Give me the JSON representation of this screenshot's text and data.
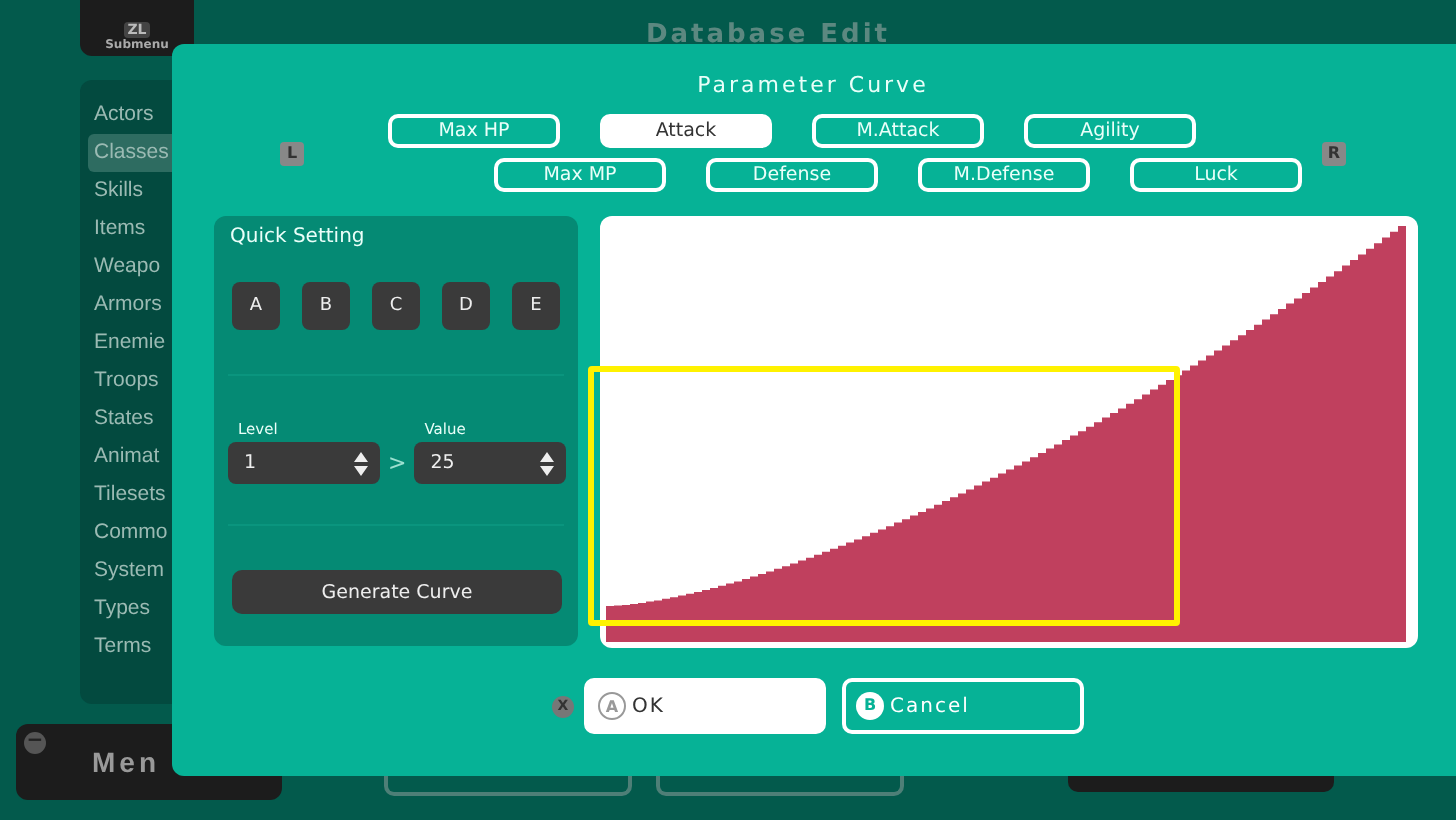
{
  "background": {
    "submenu": {
      "key": "ZL",
      "label": "Submenu"
    },
    "title": "Database Edit",
    "sidebar": {
      "items": [
        {
          "label": "Actors",
          "selected": false
        },
        {
          "label": "Classes",
          "selected": true
        },
        {
          "label": "Skills",
          "selected": false
        },
        {
          "label": "Items",
          "selected": false
        },
        {
          "label": "Weapo",
          "selected": false
        },
        {
          "label": "Armors",
          "selected": false
        },
        {
          "label": "Enemie",
          "selected": false
        },
        {
          "label": "Troops",
          "selected": false
        },
        {
          "label": "States",
          "selected": false
        },
        {
          "label": "Animat",
          "selected": false
        },
        {
          "label": "Tilesets",
          "selected": false
        },
        {
          "label": "Commo",
          "selected": false
        },
        {
          "label": "System",
          "selected": false
        },
        {
          "label": "Types",
          "selected": false
        },
        {
          "label": "Terms",
          "selected": false
        }
      ]
    },
    "menu_button": {
      "key": "−",
      "label": "Men"
    }
  },
  "dialog": {
    "title": "Parameter Curve",
    "prev_key": "L",
    "next_key": "R",
    "tabs": [
      {
        "label": "Max HP",
        "selected": false
      },
      {
        "label": "Attack",
        "selected": true
      },
      {
        "label": "M.Attack",
        "selected": false
      },
      {
        "label": "Agility",
        "selected": false
      },
      {
        "label": "Max MP",
        "selected": false
      },
      {
        "label": "Defense",
        "selected": false
      },
      {
        "label": "M.Defense",
        "selected": false
      },
      {
        "label": "Luck",
        "selected": false
      }
    ],
    "quick_setting": {
      "title": "Quick Setting",
      "presets": [
        "A",
        "B",
        "C",
        "D",
        "E"
      ],
      "level": {
        "label": "Level",
        "value": "1"
      },
      "separator": ">",
      "value": {
        "label": "Value",
        "value": "25"
      },
      "generate_button": "Generate Curve"
    },
    "hint_key": "X",
    "buttons": [
      {
        "key": "A",
        "label": "OK",
        "selected": true
      },
      {
        "key": "B",
        "label": "Cancel",
        "selected": false
      }
    ]
  }
}
